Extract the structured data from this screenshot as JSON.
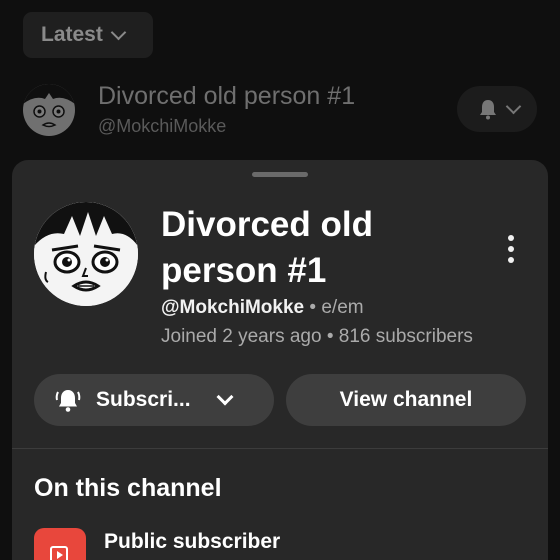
{
  "filter": {
    "label": "Latest"
  },
  "background_channel": {
    "name": "Divorced old person #1",
    "handle": "@MokchiMokke"
  },
  "sheet": {
    "channel_name": "Divorced old person #1",
    "handle": "@MokchiMokke",
    "separator": "•",
    "pronouns": "e/em",
    "joined": "Joined 2 years ago",
    "subscribers": "816 subscribers",
    "subscribe_label": "Subscri...",
    "view_channel_label": "View channel",
    "section_heading": "On this channel",
    "items": [
      {
        "label": "Public subscriber",
        "icon": "playlist-icon"
      }
    ]
  },
  "colors": {
    "background": "#0f0f0f",
    "sheet": "#282828",
    "button": "#3e3e3e",
    "accent": "#e8473c"
  }
}
